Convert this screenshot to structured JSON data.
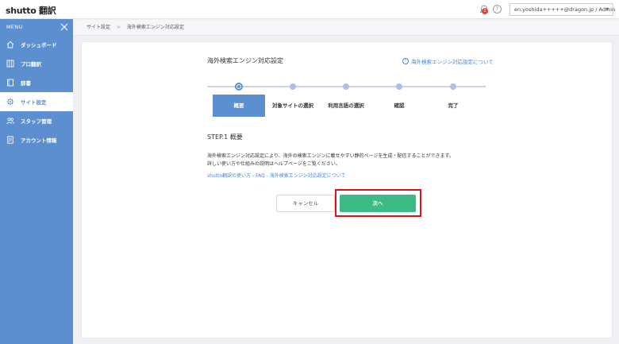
{
  "header": {
    "logo": "shutto 翻訳",
    "notification_count": "1",
    "help_label": "?",
    "user": "en.yoshida+++++@dragon.jp / Admin",
    "caret": "▼"
  },
  "sidebar": {
    "menu_label": "MENU",
    "items": [
      {
        "label": "ダッシュボード",
        "icon": "home-icon"
      },
      {
        "label": "プロ翻訳",
        "icon": "grid-icon"
      },
      {
        "label": "辞書",
        "icon": "book-icon"
      },
      {
        "label": "サイト設定",
        "icon": "gear-icon"
      },
      {
        "label": "スタッフ管理",
        "icon": "staff-icon"
      },
      {
        "label": "アカウント情報",
        "icon": "document-icon"
      }
    ],
    "active_index": 3
  },
  "breadcrumb": [
    "サイト設定",
    "海外検索エンジン対応設定"
  ],
  "breadcrumb_sep": ">",
  "page": {
    "title": "海外検索エンジン対応設定",
    "help_link": "海外検索エンジン対応設定について",
    "help_icon_glyph": "?",
    "steps": [
      "概要",
      "対象サイトの選択",
      "利用言語の選択",
      "確認",
      "完了"
    ],
    "active_step": 0,
    "step_heading": "STEP.1 概要",
    "description_line1": "海外検索エンジン対応設定により、海外の検索エンジンに載せやすい静的ページを生成・配信することができます。",
    "description_line2": "詳しい使い方や仕組みの説明はヘルプページをご覧ください。",
    "links_text": "shutto翻訳の使い方 - FAQ - 海外検索エンジン対応設定について",
    "cancel_label": "キャンセル",
    "next_label": "次へ"
  },
  "colors": {
    "sidebar": "#5b8fcf",
    "primary_button": "#3cbb86",
    "highlight": "#d9131b",
    "link": "#4a86d1"
  }
}
